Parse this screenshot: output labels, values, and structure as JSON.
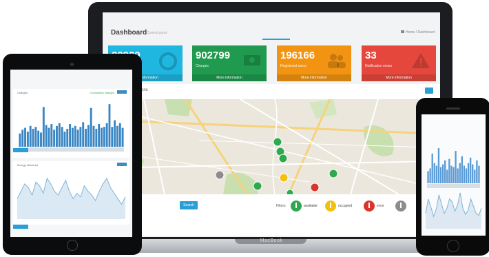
{
  "laptop": {
    "brand": "MacBook",
    "dashboard": {
      "title": "Dashboard",
      "subtitle": "Control panel",
      "breadcrumb": "Home / Dashboard",
      "tiles": [
        {
          "value": "20929",
          "label": "",
          "footer": "More information",
          "color": "#1fb6e0",
          "icon": "circle-chart-icon"
        },
        {
          "value": "902799",
          "label": "Charges",
          "footer": "More information",
          "color": "#1f9a4e",
          "icon": "card-icon"
        },
        {
          "value": "196166",
          "label": "Registered users",
          "footer": "More information",
          "color": "#f29412",
          "icon": "users-icon"
        },
        {
          "value": "33",
          "label": "Notification errors",
          "footer": "More information",
          "color": "#e5473d",
          "icon": "warning-icon"
        }
      ],
      "map_panel": {
        "title": "ons",
        "search_button": "Search",
        "filters_label": "Filters",
        "legend": [
          {
            "label": "available",
            "color": "#2fa84f"
          },
          {
            "label": "occupied",
            "color": "#f2c012"
          },
          {
            "label": "error",
            "color": "#d9352a"
          },
          {
            "label": "",
            "color": "#8d8d8d"
          }
        ]
      }
    }
  },
  "tablet": {
    "panel1": {
      "title": "Charges",
      "legend": "Connection charges"
    },
    "panel2": {
      "title": "Energy delivered"
    },
    "chart_data": [
      {
        "type": "bar",
        "title": "Charges",
        "values": [
          14,
          18,
          20,
          16,
          22,
          19,
          21,
          17,
          15,
          42,
          23,
          20,
          24,
          18,
          22,
          25,
          21,
          16,
          19,
          24,
          20,
          22,
          18,
          21,
          26,
          19,
          23,
          41,
          22,
          19,
          24,
          20,
          21,
          25,
          45,
          21,
          28,
          22,
          25,
          20
        ]
      },
      {
        "type": "area",
        "title": "Energy delivered",
        "values": [
          22,
          30,
          38,
          34,
          26,
          40,
          36,
          28,
          44,
          38,
          30,
          26,
          34,
          42,
          30,
          22,
          28,
          24,
          36,
          30,
          26,
          20,
          30,
          38,
          44,
          34,
          28,
          22,
          16,
          24
        ]
      }
    ]
  },
  "phone": {
    "chart_data": [
      {
        "type": "bar",
        "values": [
          18,
          22,
          44,
          30,
          26,
          52,
          24,
          28,
          34,
          20,
          36,
          26,
          24,
          48,
          22,
          30,
          40,
          26,
          22,
          30,
          38,
          28,
          20,
          34,
          26
        ]
      },
      {
        "type": "area",
        "values": [
          30,
          58,
          42,
          24,
          38,
          66,
          48,
          30,
          40,
          58,
          52,
          34,
          46,
          70,
          40,
          28,
          36,
          58,
          44,
          30,
          26,
          40
        ]
      }
    ]
  }
}
